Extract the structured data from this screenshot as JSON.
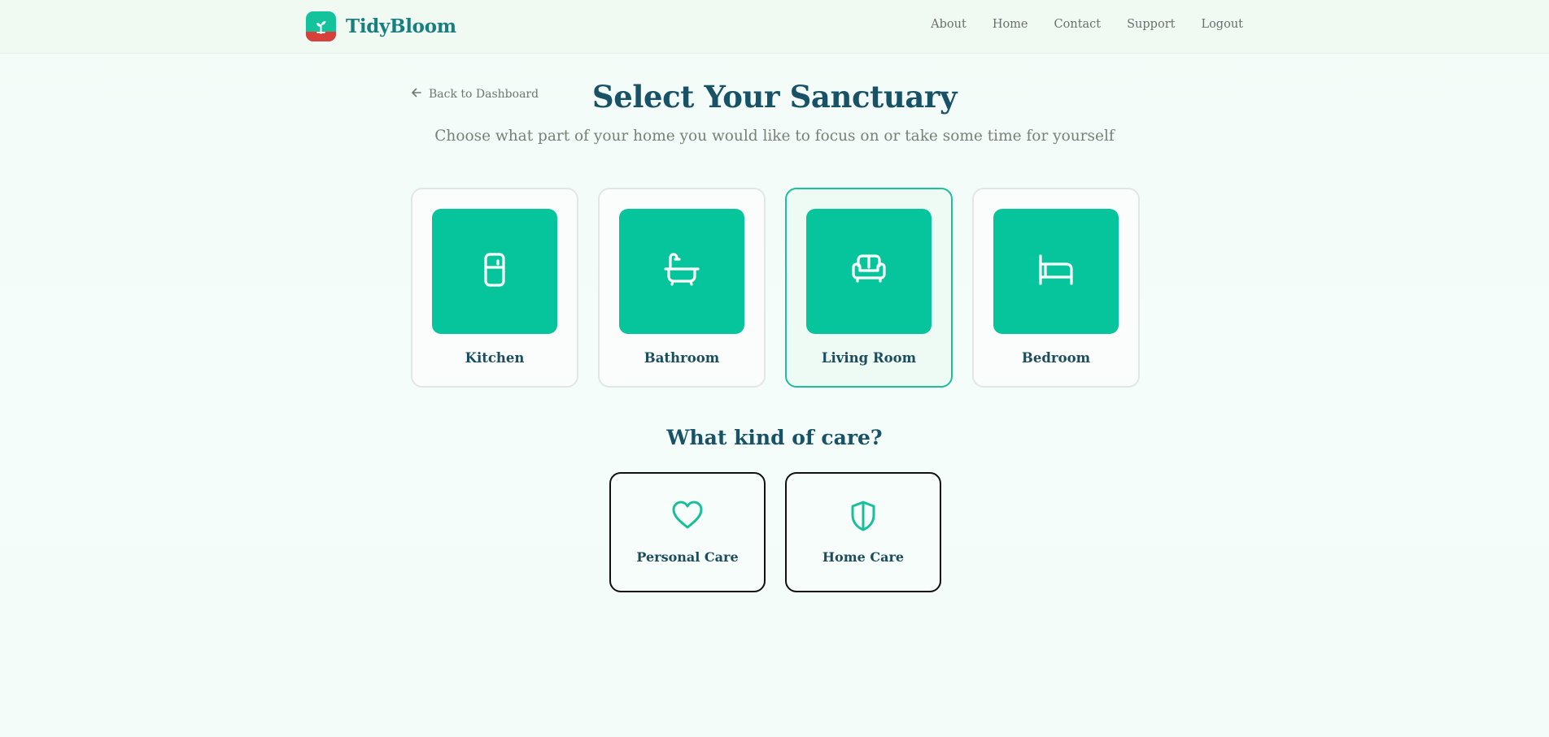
{
  "brand": {
    "name": "TidyBloom",
    "logo_icon": "sprout-icon",
    "accent": "#06c49b",
    "logo_bottom": "#d8403a"
  },
  "nav": {
    "items": [
      "About",
      "Home",
      "Contact",
      "Support",
      "Logout"
    ]
  },
  "back": {
    "label": "Back to Dashboard",
    "icon": "arrow-left-icon"
  },
  "header": {
    "title": "Select Your Sanctuary",
    "subtitle": "Choose what part of your home you would like to focus on or take some time for yourself"
  },
  "rooms": [
    {
      "label": "Kitchen",
      "icon": "refrigerator-icon",
      "selected": false
    },
    {
      "label": "Bathroom",
      "icon": "bathtub-icon",
      "selected": false
    },
    {
      "label": "Living Room",
      "icon": "sofa-icon",
      "selected": true
    },
    {
      "label": "Bedroom",
      "icon": "bed-icon",
      "selected": false
    }
  ],
  "care": {
    "heading": "What kind of care?",
    "options": [
      {
        "label": "Personal Care",
        "icon": "heart-icon"
      },
      {
        "label": "Home Care",
        "icon": "shield-icon"
      }
    ]
  }
}
